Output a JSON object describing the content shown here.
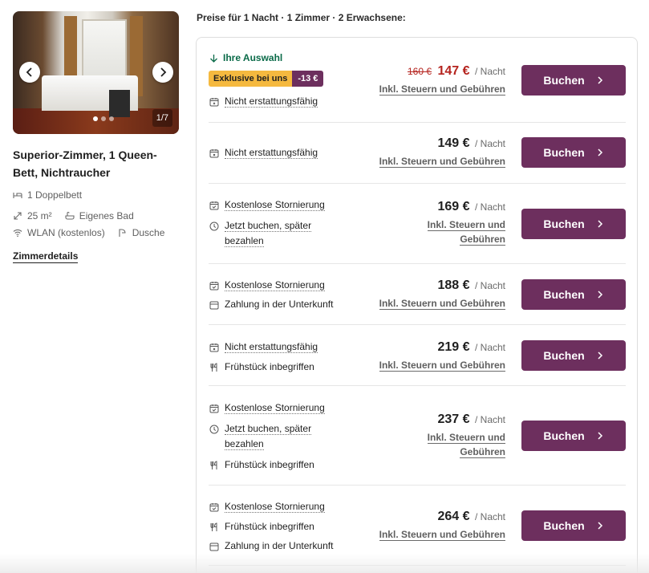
{
  "room": {
    "photo_counter": "1/7",
    "title": "Superior-Zimmer, 1 Queen-Bett, Nichtraucher",
    "amenities": {
      "bed": "1 Doppelbett",
      "size": "25 m²",
      "bath": "Eigenes Bad",
      "wifi": "WLAN (kostenlos)",
      "shower": "Dusche"
    },
    "details_link": "Zimmerdetails"
  },
  "offers": {
    "heading": "Preise für 1 Nacht · 1 Zimmer · 2 Erwachsene:",
    "your_choice": "Ihre Auswahl",
    "exclusive_badge": "Exklusive bei uns",
    "discount_badge": "-13 €",
    "per_night": "/ Nacht",
    "tax_note": "Inkl. Steuern und Gebühren",
    "tax_note_line1": "Inkl. Steuern und",
    "tax_note_line2": "Gebühren",
    "book_label": "Buchen",
    "options": {
      "nonref": "Nicht erstattungsfähig",
      "freecancel": "Kostenlose Stornierung",
      "paylater_line1": "Jetzt buchen, später",
      "paylater_line2": "bezahlen",
      "payatprop": "Zahlung in der Unterkunft",
      "breakfast": "Frühstück inbegriffen"
    },
    "rates": [
      {
        "old_price": "160 €",
        "price": "147 €"
      },
      {
        "price": "149 €"
      },
      {
        "price": "169 €"
      },
      {
        "price": "188 €"
      },
      {
        "price": "219 €"
      },
      {
        "price": "237 €"
      },
      {
        "price": "264 €"
      }
    ]
  },
  "colors": {
    "brand": "#6d2f5e",
    "badge": "#f5b93f",
    "discount_price": "#b5241f",
    "choice_green": "#0b6b49"
  }
}
